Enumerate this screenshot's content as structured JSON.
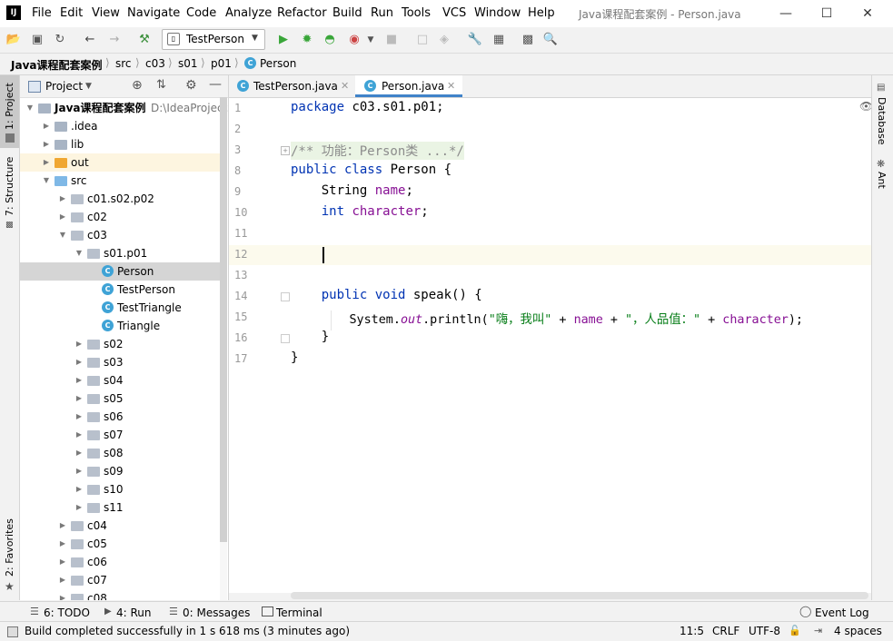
{
  "title_bar": {
    "logo": "IJ",
    "menu": [
      "File",
      "Edit",
      "View",
      "Navigate",
      "Code",
      "Analyze",
      "Refactor",
      "Build",
      "Run",
      "Tools",
      "VCS",
      "Window",
      "Help"
    ],
    "window_title": "Java课程配套案例 - Person.java"
  },
  "toolbar": {
    "run_config": "TestPerson"
  },
  "breadcrumb": [
    "Java课程配套案例",
    "src",
    "c03",
    "s01",
    "p01",
    "Person"
  ],
  "left_strip": {
    "project_tab": "1: Project",
    "structure_tab": "7: Structure",
    "favorites_tab": "2: Favorites"
  },
  "right_strip": {
    "database_tab": "Database",
    "ant_tab": "Ant"
  },
  "project_panel": {
    "title": "Project",
    "tree": [
      {
        "label": "Java课程配套案例",
        "extra": "D:\\IdeaProjects",
        "level": 0,
        "open": true,
        "kind": "module"
      },
      {
        "label": ".idea",
        "level": 1,
        "open": false,
        "kind": "folder"
      },
      {
        "label": "lib",
        "level": 1,
        "open": false,
        "kind": "folder"
      },
      {
        "label": "out",
        "level": 1,
        "open": false,
        "kind": "folder-orange"
      },
      {
        "label": "src",
        "level": 1,
        "open": true,
        "kind": "folder-blue"
      },
      {
        "label": "c01.s02.p02",
        "level": 2,
        "open": false,
        "kind": "pkg"
      },
      {
        "label": "c02",
        "level": 2,
        "open": false,
        "kind": "pkg"
      },
      {
        "label": "c03",
        "level": 2,
        "open": true,
        "kind": "pkg"
      },
      {
        "label": "s01.p01",
        "level": 3,
        "open": true,
        "kind": "pkg"
      },
      {
        "label": "Person",
        "level": 4,
        "kind": "class",
        "selected": true
      },
      {
        "label": "TestPerson",
        "level": 4,
        "kind": "class-run"
      },
      {
        "label": "TestTriangle",
        "level": 4,
        "kind": "class-run"
      },
      {
        "label": "Triangle",
        "level": 4,
        "kind": "class"
      },
      {
        "label": "s02",
        "level": 3,
        "open": false,
        "kind": "pkg"
      },
      {
        "label": "s03",
        "level": 3,
        "open": false,
        "kind": "pkg"
      },
      {
        "label": "s04",
        "level": 3,
        "open": false,
        "kind": "pkg"
      },
      {
        "label": "s05",
        "level": 3,
        "open": false,
        "kind": "pkg"
      },
      {
        "label": "s06",
        "level": 3,
        "open": false,
        "kind": "pkg"
      },
      {
        "label": "s07",
        "level": 3,
        "open": false,
        "kind": "pkg"
      },
      {
        "label": "s08",
        "level": 3,
        "open": false,
        "kind": "pkg"
      },
      {
        "label": "s09",
        "level": 3,
        "open": false,
        "kind": "pkg"
      },
      {
        "label": "s10",
        "level": 3,
        "open": false,
        "kind": "pkg"
      },
      {
        "label": "s11",
        "level": 3,
        "open": false,
        "kind": "pkg"
      },
      {
        "label": "c04",
        "level": 2,
        "open": false,
        "kind": "pkg"
      },
      {
        "label": "c05",
        "level": 2,
        "open": false,
        "kind": "pkg"
      },
      {
        "label": "c06",
        "level": 2,
        "open": false,
        "kind": "pkg"
      },
      {
        "label": "c07",
        "level": 2,
        "open": false,
        "kind": "pkg"
      },
      {
        "label": "c08",
        "level": 2,
        "open": false,
        "kind": "pkg"
      }
    ]
  },
  "editor": {
    "tabs": [
      {
        "label": "TestPerson.java",
        "active": false
      },
      {
        "label": "Person.java",
        "active": true
      }
    ],
    "line_numbers": [
      "1",
      "2",
      "3",
      "8",
      "9",
      "10",
      "11",
      "12",
      "13",
      "14",
      "15",
      "16",
      "17"
    ],
    "code": {
      "l1_kw": "package",
      "l1_rest": " c03.s01.p01;",
      "l3": "/** 功能：Person类 ...*/",
      "l8_kw": "public class",
      "l8_rest": " Person {",
      "l9_type": "    String ",
      "l9_fld": "name",
      "l9_end": ";",
      "l10_kw": "    int ",
      "l10_fld": "character",
      "l10_end": ";",
      "l14_kw": "    public void",
      "l14_rest": " speak() {",
      "l15_a": "        System.",
      "l15_out": "out",
      "l15_b": ".println(",
      "l15_s1": "\"嗨，我叫\"",
      "l15_c": " + ",
      "l15_f1": "name",
      "l15_d": " + ",
      "l15_s2": "\"，人品值：\"",
      "l15_e": " + ",
      "l15_f2": "character",
      "l15_f": ");",
      "l16": "    }",
      "l17": "}"
    }
  },
  "bottom_bar": {
    "todo": "6: TODO",
    "run": "4: Run",
    "messages": "0: Messages",
    "terminal": "Terminal",
    "event_log": "Event Log"
  },
  "status_bar": {
    "message": "Build completed successfully in 1 s 618 ms (3 minutes ago)",
    "position": "11:5",
    "line_sep": "CRLF",
    "encoding": "UTF-8",
    "indent": "4 spaces"
  }
}
